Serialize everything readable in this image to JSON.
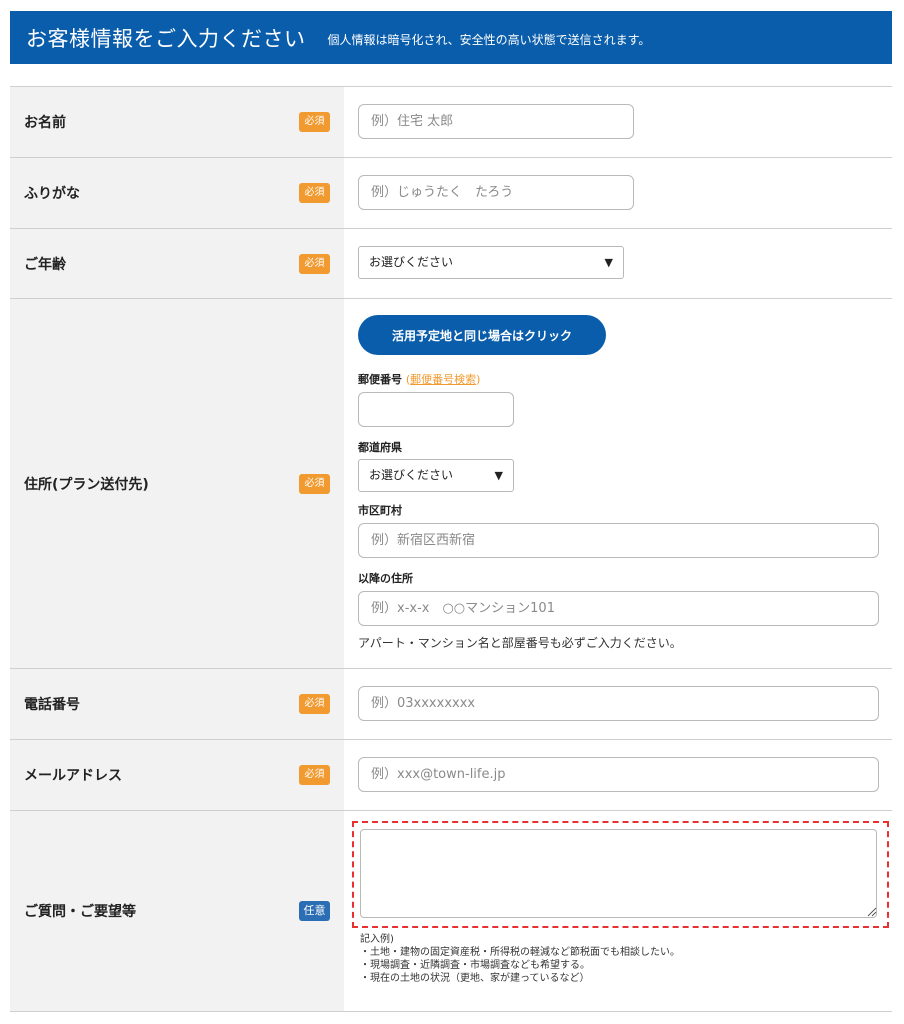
{
  "header": {
    "title": "お客様情報をご入力ください",
    "note": "個人情報は暗号化され、安全性の高い状態で送信されます。"
  },
  "badges": {
    "required": "必須",
    "optional": "任意"
  },
  "fields": {
    "name": {
      "label": "お名前",
      "placeholder": "例）住宅 太郎"
    },
    "furigana": {
      "label": "ふりがな",
      "placeholder": "例）じゅうたく　たろう"
    },
    "age": {
      "label": "ご年齢",
      "selected": "お選びください"
    },
    "address": {
      "label": "住所(プラン送付先)",
      "same_button": "活用予定地と同じ場合はクリック",
      "zip_label": "郵便番号",
      "zip_open": "(",
      "zip_link": "郵便番号検索",
      "zip_close": ")",
      "prefecture_label": "都道府県",
      "prefecture_selected": "お選びください",
      "city_label": "市区町村",
      "city_placeholder": "例）新宿区西新宿",
      "rest_label": "以降の住所",
      "rest_placeholder": "例）x-x-x　○○マンション101",
      "rest_hint": "アパート・マンション名と部屋番号も必ずご入力ください。"
    },
    "phone": {
      "label": "電話番号",
      "placeholder": "例）03xxxxxxxx"
    },
    "email": {
      "label": "メールアドレス",
      "placeholder": "例）xxx@town-life.jp"
    },
    "questions": {
      "label": "ご質問・ご要望等",
      "example_title": "記入例)",
      "examples": [
        "・土地・建物の固定資産税・所得税の軽減など節税面でも相談したい。",
        "・現場調査・近隣調査・市場調査なども希望する。",
        "・現在の土地の状況（更地、家が建っているなど）"
      ]
    }
  },
  "icons": {
    "caret": "triangle-down-icon",
    "resize": "resize-grip-icon"
  },
  "colors": {
    "header_bg": "#0a5dab",
    "required_badge": "#f19a2f",
    "optional_badge": "#2c6eb4",
    "highlight_dashed": "#e83030"
  }
}
